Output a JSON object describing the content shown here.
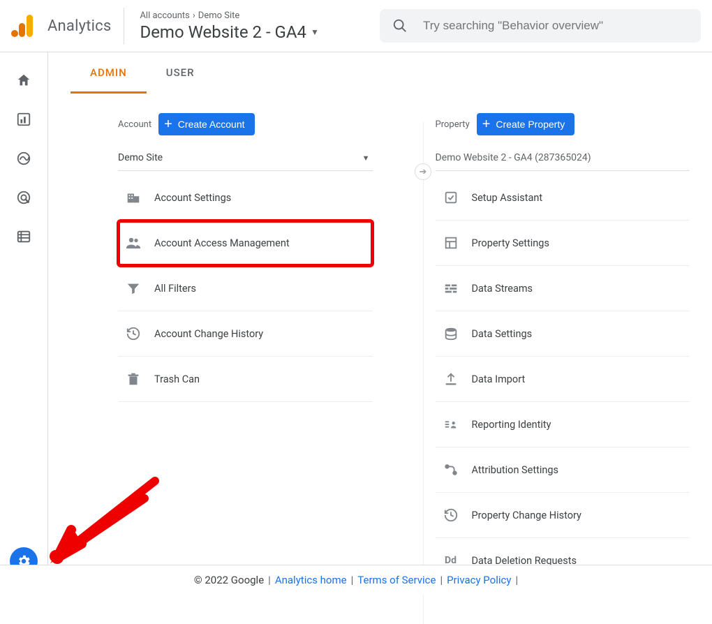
{
  "brand": "Analytics",
  "breadcrumb": {
    "root": "All accounts",
    "site": "Demo Site"
  },
  "propertyPicker": "Demo Website 2 - GA4",
  "search": {
    "placeholder": "Try searching \"Behavior overview\""
  },
  "tabs": {
    "admin": "ADMIN",
    "user": "USER"
  },
  "account": {
    "label": "Account",
    "createBtn": "Create Account",
    "picker": "Demo Site",
    "items": [
      {
        "label": "Account Settings"
      },
      {
        "label": "Account Access Management"
      },
      {
        "label": "All Filters"
      },
      {
        "label": "Account Change History"
      },
      {
        "label": "Trash Can"
      }
    ]
  },
  "property": {
    "label": "Property",
    "createBtn": "Create Property",
    "picker": "Demo Website 2 - GA4 (287365024)",
    "items": [
      {
        "label": "Setup Assistant"
      },
      {
        "label": "Property Settings"
      },
      {
        "label": "Data Streams"
      },
      {
        "label": "Data Settings"
      },
      {
        "label": "Data Import"
      },
      {
        "label": "Reporting Identity"
      },
      {
        "label": "Attribution Settings"
      },
      {
        "label": "Property Change History"
      },
      {
        "label": "Data Deletion Requests"
      }
    ]
  },
  "footer": {
    "copyright": "© 2022 Google",
    "links": [
      "Analytics home",
      "Terms of Service",
      "Privacy Policy"
    ]
  }
}
